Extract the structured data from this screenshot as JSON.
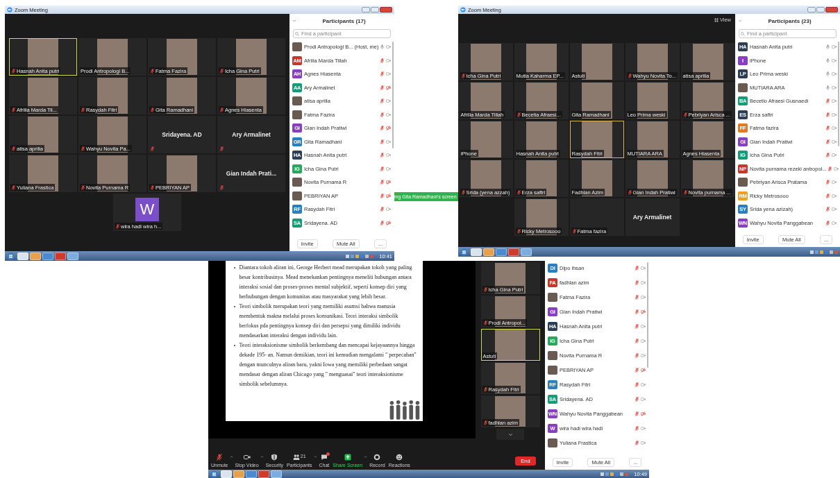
{
  "windows": [
    {
      "kind": "gallery",
      "title": "Zoom Meeting",
      "participants_title": "Participants (17)",
      "search_placeholder": "Find a participant",
      "panel_buttons": [
        "Invite",
        "Mute All",
        "..."
      ],
      "clock": "10:41",
      "tile_rows": [
        [
          {
            "name": "Hasnah Anita putri",
            "kind": "video",
            "muted": true,
            "active": true
          },
          {
            "name": "Prodi Antropologi B...",
            "kind": "video",
            "muted": false,
            "active": false
          },
          {
            "name": "Fatma Fazira",
            "kind": "video",
            "muted": true,
            "active": false
          },
          {
            "name": "Icha Gina Putri",
            "kind": "video",
            "muted": true,
            "active": false
          }
        ],
        [
          {
            "name": "Afrilia Marda Til...",
            "kind": "video",
            "muted": true,
            "active": false
          },
          {
            "name": "Rasydah Fitri",
            "kind": "video",
            "muted": true,
            "active": false
          },
          {
            "name": "Gita Ramadhani",
            "kind": "video",
            "muted": true,
            "active": false
          },
          {
            "name": "Agnes Hiasenta",
            "kind": "video",
            "muted": true,
            "active": false
          }
        ],
        [
          {
            "name": "atisa aprilia",
            "kind": "video",
            "muted": true,
            "active": false
          },
          {
            "name": "Wahyu Novita Pa...",
            "kind": "video",
            "muted": true,
            "active": false
          },
          {
            "name": "Sridayena. AD",
            "kind": "name",
            "muted": true,
            "active": false
          },
          {
            "name": "Ary Armalinet",
            "kind": "name",
            "muted": true,
            "active": false
          }
        ],
        [
          {
            "name": "Yuliana Frastica",
            "kind": "video",
            "muted": true,
            "active": false
          },
          {
            "name": "Novita Purnama R",
            "kind": "video",
            "muted": true,
            "active": false
          },
          {
            "name": "PEBRIYAN AP",
            "kind": "video",
            "muted": true,
            "active": false
          },
          {
            "name": "Gian Indah Prati...",
            "kind": "name",
            "muted": true,
            "active": false
          }
        ],
        [
          {
            "name": "wira  hadi wira h...",
            "kind": "avatar",
            "initial": "W",
            "color": "#7a4fc9",
            "muted": true,
            "active": false
          }
        ]
      ],
      "participants": [
        {
          "name": "Prodi Antropologi B...",
          "tag": "(Host, me)",
          "kind": "photo",
          "muted": false,
          "video_off": false
        },
        {
          "name": "Afrilia Marda Tillah",
          "initials": "AM",
          "color": "#c8372d",
          "kind": "initials",
          "muted": true,
          "video_off": false
        },
        {
          "name": "Agnes Hiasenta",
          "initials": "AH",
          "color": "#8a3fc2",
          "kind": "initials",
          "muted": true,
          "video_off": false
        },
        {
          "name": "Ary Armalinet",
          "initials": "AA",
          "color": "#179c78",
          "kind": "initials",
          "muted": true,
          "video_off": true
        },
        {
          "name": "atisa aprilia",
          "kind": "photo",
          "muted": true,
          "video_off": false
        },
        {
          "name": "Fatma Fazira",
          "kind": "photo",
          "muted": true,
          "video_off": false
        },
        {
          "name": "Gian Indah Pratiwi",
          "initials": "GI",
          "color": "#8a3fc2",
          "kind": "initials",
          "muted": true,
          "video_off": true
        },
        {
          "name": "Gita Ramadhani",
          "initials": "GR",
          "color": "#2a7fc0",
          "kind": "initials",
          "muted": true,
          "video_off": false
        },
        {
          "name": "Hasnah Anita putri",
          "initials": "HA",
          "color": "#2c3e55",
          "kind": "initials",
          "muted": true,
          "video_off": false
        },
        {
          "name": "Icha Gina Putri",
          "initials": "IG",
          "color": "#27a85a",
          "kind": "initials",
          "muted": true,
          "video_off": false
        },
        {
          "name": "Novita Purnama R",
          "kind": "photo",
          "muted": true,
          "video_off": true
        },
        {
          "name": "PEBRIYAN AP",
          "kind": "photo",
          "muted": true,
          "video_off": true
        },
        {
          "name": "Rasydah Fitri",
          "initials": "RF",
          "color": "#2a7fc0",
          "kind": "initials",
          "muted": true,
          "video_off": false
        },
        {
          "name": "Sridayena. AD",
          "initials": "SA",
          "color": "#179c78",
          "kind": "initials",
          "muted": true,
          "video_off": true
        }
      ]
    },
    {
      "kind": "gallery",
      "title": "Zoom Meeting",
      "view_label": "View",
      "participants_title": "Participants (23)",
      "search_placeholder": "Find a participant",
      "panel_buttons": [
        "Invite",
        "Mute All",
        "..."
      ],
      "tile_rows": [
        [
          {
            "name": "Icha Gina Putri",
            "kind": "video",
            "muted": true,
            "active": false
          },
          {
            "name": "Mutia Kaharma EP...",
            "kind": "video",
            "muted": false,
            "active": false
          },
          {
            "name": "Astuti",
            "kind": "video",
            "muted": false,
            "active": false
          },
          {
            "name": "Wahyu Novita To...",
            "kind": "video",
            "muted": true,
            "active": false
          },
          {
            "name": "atisa aprilia",
            "kind": "video",
            "muted": false,
            "active": false
          }
        ],
        [
          {
            "name": "Afrilia Marda Tillah",
            "kind": "video",
            "muted": false,
            "active": false
          },
          {
            "name": "Becetia Afraesi...",
            "kind": "video",
            "muted": true,
            "active": false
          },
          {
            "name": "Gita Ramadhani",
            "kind": "video",
            "muted": false,
            "active": false
          },
          {
            "name": "Leo Prima weski",
            "kind": "video",
            "muted": false,
            "active": false
          },
          {
            "name": "Pebriyan Arisca ...",
            "kind": "video",
            "muted": true,
            "active": false
          }
        ],
        [
          {
            "name": "iPhone",
            "kind": "video",
            "muted": false,
            "active": false
          },
          {
            "name": "Hasnah Anita putri",
            "kind": "video",
            "muted": false,
            "active": false
          },
          {
            "name": "Rasydah Fitri",
            "kind": "video",
            "muted": false,
            "active": true
          },
          {
            "name": "MUTIARA ARA",
            "kind": "video",
            "muted": false,
            "active": false
          },
          {
            "name": "Agnes Hiasenta",
            "kind": "video",
            "muted": false,
            "active": false
          }
        ],
        [
          {
            "name": "Srida (yena azzah)",
            "kind": "video",
            "muted": true,
            "active": false
          },
          {
            "name": "Erza saftri",
            "kind": "video",
            "muted": true,
            "active": false
          },
          {
            "name": "Fadhlan Azim",
            "kind": "video",
            "muted": false,
            "active": false
          },
          {
            "name": "Gian Indah Pratiwi",
            "kind": "video",
            "muted": true,
            "active": false
          },
          {
            "name": "Novita purnama ...",
            "kind": "video",
            "muted": true,
            "active": false
          }
        ],
        [
          {
            "name": "Ricky Metrosooo",
            "kind": "video",
            "muted": true,
            "active": false
          },
          {
            "name": "Fatma fazira",
            "kind": "blank",
            "muted": true,
            "active": false
          },
          {
            "name": "Ary Armalinet",
            "kind": "name",
            "muted": false,
            "active": false
          }
        ]
      ],
      "participants": [
        {
          "name": "Hasnah Anita putri",
          "initials": "HA",
          "color": "#2c3e55",
          "kind": "initials",
          "muted": false,
          "video_off": false
        },
        {
          "name": "iPhone",
          "initials": "I",
          "color": "#8a3fc2",
          "kind": "initials",
          "muted": false,
          "video_off": false
        },
        {
          "name": "Leo Prima weski",
          "initials": "LP",
          "color": "#2c3e55",
          "kind": "initials",
          "muted": false,
          "video_off": false
        },
        {
          "name": "MUTIARA ARA",
          "kind": "photo",
          "muted": false,
          "video_off": false
        },
        {
          "name": "Becetio Afraesi Gusnaedi",
          "initials": "BA",
          "color": "#179c78",
          "kind": "initials",
          "muted": true,
          "video_off": false
        },
        {
          "name": "Erza saftri",
          "initials": "ES",
          "color": "#2c3e55",
          "kind": "initials",
          "muted": true,
          "video_off": false
        },
        {
          "name": "Fatma fazira",
          "initials": "FF",
          "color": "#e07b22",
          "kind": "initials",
          "muted": true,
          "video_off": false
        },
        {
          "name": "Gian Indah Pratiwi",
          "initials": "GI",
          "color": "#8a3fc2",
          "kind": "initials",
          "muted": true,
          "video_off": false
        },
        {
          "name": "Icha Gina Putri",
          "initials": "IG",
          "color": "#179c78",
          "kind": "initials",
          "muted": true,
          "video_off": false
        },
        {
          "name": "Novita purnama rezeki antropol...",
          "initials": "NP",
          "color": "#c8372d",
          "kind": "initials",
          "muted": true,
          "video_off": false
        },
        {
          "name": "Pebriyan Arisca Pratama",
          "kind": "photo",
          "muted": true,
          "video_off": false
        },
        {
          "name": "Ricky Metrosooo",
          "initials": "RM",
          "color": "#f0a020",
          "kind": "initials",
          "muted": true,
          "video_off": false
        },
        {
          "name": "Srida yena azizah)",
          "initials": "SY",
          "color": "#2a7fc0",
          "kind": "initials",
          "muted": true,
          "video_off": false
        },
        {
          "name": "Wahyu Novita Panggabean",
          "initials": "WN",
          "color": "#8a3fc2",
          "kind": "initials",
          "muted": true,
          "video_off": false
        }
      ]
    },
    {
      "kind": "presentation",
      "share_banner": "ing Gita Ramadhani's screen",
      "clock": "10:49",
      "slide_bullets": [
        "Diantara tokoh aliran ini, George Herbert mead merupakan tokoh yang paling besar kontribusinya. Mead menekankan pentingnya meneliti hubungan antara interaksi sosial dan proses-proses mental subjektif, seperti konsep diri yang berhubungan dengan komunitas atau masyarakat yang lebih besar.",
        "Teori simbolik merupakan teori yang memiliki asumsi bahwa manusia membentuk makna melalui proses komunikasi. Teori interaksi simbolik berfokus pda pentingnya konsep diri dan persepsi yang dimiliki individu mendasarkan interaksi dengan individu lain.",
        "Teori interaksionisme simbolik berkembang dan mencapai kejayaannya hingga dekade 195- an. Namun demikian, teori ini kemudian mengalami \" perpecahan\" dengan munculnya aliran baru, yakni Iowa yang memiliki perbedaan sangat mendasar dengan aliran Chicago yang \" menguasai\" teori interaksionisme simbolik sebelumnya."
      ],
      "toolbar": [
        {
          "kind": "unmute",
          "label": "Unmute",
          "caret": true
        },
        {
          "kind": "video",
          "label": "Stop Video",
          "caret": true
        },
        {
          "kind": "security",
          "label": "Security",
          "caret": false
        },
        {
          "kind": "participants",
          "label": "Participants",
          "count": "21",
          "caret": true
        },
        {
          "kind": "chat",
          "label": "Chat",
          "caret": false
        },
        {
          "kind": "share",
          "label": "Share Screen",
          "caret": true
        },
        {
          "kind": "record",
          "label": "Record",
          "caret": false
        },
        {
          "kind": "reactions",
          "label": "Reactions",
          "caret": false
        }
      ],
      "strip_tiles": [
        {
          "name": "Icha Gina Putri",
          "muted": true,
          "active": false
        },
        {
          "name": "Prodi Antropol...",
          "muted": true,
          "active": false
        },
        {
          "name": "Astuti",
          "muted": false,
          "active": true
        },
        {
          "name": "Rasydah Fitri",
          "muted": true,
          "active": false
        },
        {
          "name": "fadhlan azim",
          "muted": true,
          "active": false
        }
      ],
      "end_label": "End",
      "panel_buttons": [
        "Invite",
        "Mute All",
        "..."
      ],
      "participants": [
        {
          "name": "Dipo ihsan",
          "initials": "DI",
          "color": "#2a7fc0",
          "kind": "initials",
          "muted": true,
          "video_off": false
        },
        {
          "name": "fadhlan azim",
          "initials": "FA",
          "color": "#c8372d",
          "kind": "initials",
          "muted": true,
          "video_off": false
        },
        {
          "name": "Fatma Fazira",
          "kind": "photo",
          "muted": true,
          "video_off": false
        },
        {
          "name": "Gian Indah Pratiwi",
          "initials": "GI",
          "color": "#8a3fc2",
          "kind": "initials",
          "muted": true,
          "video_off": true
        },
        {
          "name": "Hasnah Anita putri",
          "initials": "HA",
          "color": "#2c3e55",
          "kind": "initials",
          "muted": true,
          "video_off": false
        },
        {
          "name": "Icha Gina Putri",
          "initials": "IG",
          "color": "#27a85a",
          "kind": "initials",
          "muted": true,
          "video_off": false
        },
        {
          "name": "Novita Purnama R",
          "kind": "photo",
          "muted": true,
          "video_off": false
        },
        {
          "name": "PEBRIYAN AP",
          "kind": "photo",
          "muted": true,
          "video_off": true
        },
        {
          "name": "Rasydah Fitri",
          "initials": "RF",
          "color": "#2a7fc0",
          "kind": "initials",
          "muted": true,
          "video_off": false
        },
        {
          "name": "Sridayena. AD",
          "initials": "SA",
          "color": "#179c78",
          "kind": "initials",
          "muted": true,
          "video_off": false
        },
        {
          "name": "Wahyu Novita Panggabean",
          "initials": "WN",
          "color": "#8a3fc2",
          "kind": "initials",
          "muted": true,
          "video_off": true
        },
        {
          "name": "wira  hadi wira hadi",
          "initials": "W",
          "color": "#8a3fc2",
          "kind": "initials",
          "muted": true,
          "video_off": false
        },
        {
          "name": "Yuliana Frastica",
          "kind": "photo",
          "muted": true,
          "video_off": false
        }
      ]
    }
  ]
}
